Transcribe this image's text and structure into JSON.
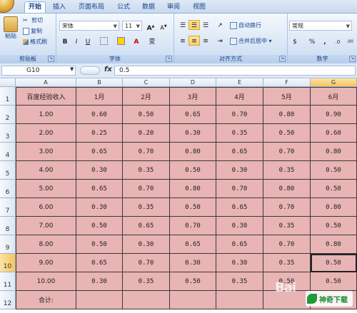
{
  "ribbon": {
    "tabs": [
      "开始",
      "插入",
      "页面布局",
      "公式",
      "数据",
      "审阅",
      "视图"
    ],
    "active_tab": "开始",
    "clipboard": {
      "paste": "粘贴",
      "cut": "剪切",
      "copy": "复制",
      "format_painter": "格式刷",
      "label": "剪贴板"
    },
    "font": {
      "name": "宋体",
      "size": "11",
      "bold": "B",
      "italic": "I",
      "underline": "U",
      "grow": "A",
      "shrink": "A",
      "font_color": "A",
      "phonetic": "变",
      "label": "字体"
    },
    "alignment": {
      "wrap_text": "自动换行",
      "merge_center": "合并后居中",
      "label": "对齐方式"
    },
    "number": {
      "format": "常规",
      "currency": "$",
      "percent": "%",
      "comma": ",",
      "increase_decimal": ".0",
      "decrease_decimal": ".00",
      "label": "数字"
    }
  },
  "formula_bar": {
    "name_box": "G10",
    "fx": "fx",
    "value": "0.5"
  },
  "columns": [
    "A",
    "B",
    "C",
    "D",
    "E",
    "F",
    "G"
  ],
  "selected_column": "G",
  "selected_row": "10",
  "rows": [
    "1",
    "2",
    "3",
    "4",
    "5",
    "6",
    "7",
    "8",
    "9",
    "10",
    "11",
    "12"
  ],
  "sheet": [
    [
      "百度经验收入",
      "1月",
      "2月",
      "3月",
      "4月",
      "5月",
      "6月"
    ],
    [
      "1.00",
      "0.60",
      "0.50",
      "0.65",
      "0.70",
      "0.80",
      "0.90"
    ],
    [
      "2.00",
      "0.25",
      "0.20",
      "0.30",
      "0.35",
      "0.50",
      "0.60"
    ],
    [
      "3.00",
      "0.65",
      "0.70",
      "0.80",
      "0.65",
      "0.70",
      "0.80"
    ],
    [
      "4.00",
      "0.30",
      "0.35",
      "0.50",
      "0.30",
      "0.35",
      "0.50"
    ],
    [
      "5.00",
      "0.65",
      "0.70",
      "0.80",
      "0.70",
      "0.80",
      "0.50"
    ],
    [
      "6.00",
      "0.30",
      "0.35",
      "0.50",
      "0.65",
      "0.70",
      "0.80"
    ],
    [
      "7.00",
      "0.50",
      "0.65",
      "0.70",
      "0.30",
      "0.35",
      "0.50"
    ],
    [
      "8.00",
      "0.50",
      "0.30",
      "0.65",
      "0.65",
      "0.70",
      "0.80"
    ],
    [
      "9.00",
      "0.65",
      "0.70",
      "0.30",
      "0.30",
      "0.35",
      "0.50"
    ],
    [
      "10.00",
      "0.30",
      "0.35",
      "0.50",
      "0.35",
      "0.50",
      "0.50"
    ],
    [
      "合计:",
      "",
      "",
      "",
      "",
      "",
      ""
    ]
  ],
  "watermark": {
    "baidu": "Bai",
    "logo_text": "神奇下载"
  },
  "colors": {
    "cell_fill": "#e8b4b4",
    "ribbon_blue": "#dbe7f6",
    "header_selected": "#f7c45e"
  }
}
